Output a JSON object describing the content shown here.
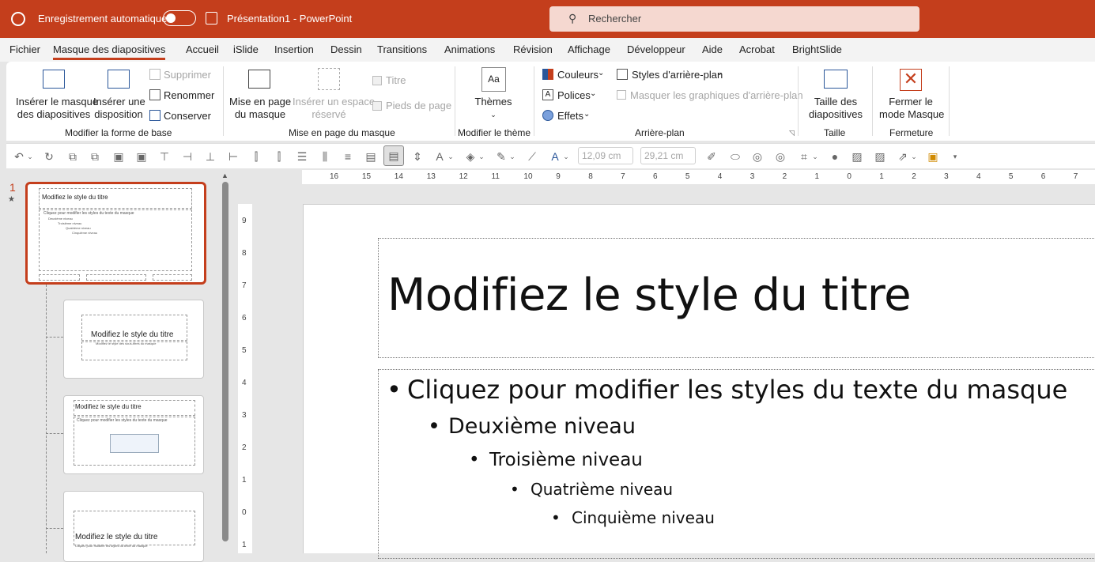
{
  "titlebar": {
    "autosave_label": "Enregistrement automatique",
    "doc_title": "Présentation1  -  PowerPoint",
    "search_placeholder": "Rechercher"
  },
  "tabs": [
    {
      "label": "Fichier"
    },
    {
      "label": "Masque des diapositives",
      "active": true
    },
    {
      "label": "Accueil"
    },
    {
      "label": "iSlide"
    },
    {
      "label": "Insertion"
    },
    {
      "label": "Dessin"
    },
    {
      "label": "Transitions"
    },
    {
      "label": "Animations"
    },
    {
      "label": "Révision"
    },
    {
      "label": "Affichage"
    },
    {
      "label": "Développeur"
    },
    {
      "label": "Aide"
    },
    {
      "label": "Acrobat"
    },
    {
      "label": "BrightSlide"
    }
  ],
  "ribbon": {
    "insert_master_1": "Insérer le masque",
    "insert_master_2": "des diapositives",
    "insert_layout_1": "Insérer une",
    "insert_layout_2": "disposition",
    "delete": "Supprimer",
    "rename": "Renommer",
    "preserve": "Conserver",
    "group_edit_master": "Modifier la forme de base",
    "master_layout_1": "Mise en page",
    "master_layout_2": "du masque",
    "insert_placeholder_1": "Insérer un espace",
    "insert_placeholder_2": "réservé",
    "title_check": "Titre",
    "footers_check": "Pieds de page",
    "group_master_layout": "Mise en page du masque",
    "themes": "Thèmes",
    "group_edit_theme": "Modifier le thème",
    "colors": "Couleurs",
    "fonts": "Polices",
    "effects": "Effets",
    "bg_styles": "Styles d'arrière-plan",
    "hide_bg": "Masquer les graphiques d'arrière-plan",
    "group_background": "Arrière-plan",
    "slide_size_1": "Taille des",
    "slide_size_2": "diapositives",
    "group_size": "Taille",
    "close_1": "Fermer le",
    "close_2": "mode Masque",
    "group_close": "Fermeture"
  },
  "qat": {
    "width_value": "12,09 cm",
    "height_value": "29,21 cm"
  },
  "pane": {
    "slide_number": "1",
    "thumb1_title": "Modifiez le style du titre",
    "thumb1_body": "Cliquez pour modifier les styles du texte du masque",
    "thumb1_l2": "Deuxième niveau",
    "thumb1_l3": "Troisième niveau",
    "thumb1_l4": "Quatrième niveau",
    "thumb1_l5": "Cinquième niveau",
    "thumb2_title": "Modifiez le style du titre",
    "thumb2_sub": "Modifiez le style des sous-titres du masque",
    "thumb3_title": "Modifiez le style du titre",
    "thumb3_body": "Cliquez pour modifier les styles du texte du masque",
    "thumb4_title": "Modifiez le style du titre",
    "thumb4_sub": "Cliquez pour modifier les styles du texte du masque"
  },
  "ruler": {
    "h": [
      "16",
      "15",
      "14",
      "13",
      "12",
      "11",
      "10",
      "9",
      "8",
      "7",
      "6",
      "5",
      "4",
      "3",
      "2",
      "1",
      "0",
      "1",
      "2",
      "3",
      "4",
      "5",
      "6",
      "7"
    ],
    "v": [
      "9",
      "8",
      "7",
      "6",
      "5",
      "4",
      "3",
      "2",
      "1",
      "0",
      "1"
    ]
  },
  "slide": {
    "title": "Modifiez le style du titre",
    "level1": "Cliquez pour modifier les styles du texte du masque",
    "level2": "Deuxième niveau",
    "level3": "Troisième niveau",
    "level4": "Quatrième niveau",
    "level5": "Cinquième niveau"
  },
  "colors": {
    "accent": "#c43e1c"
  }
}
